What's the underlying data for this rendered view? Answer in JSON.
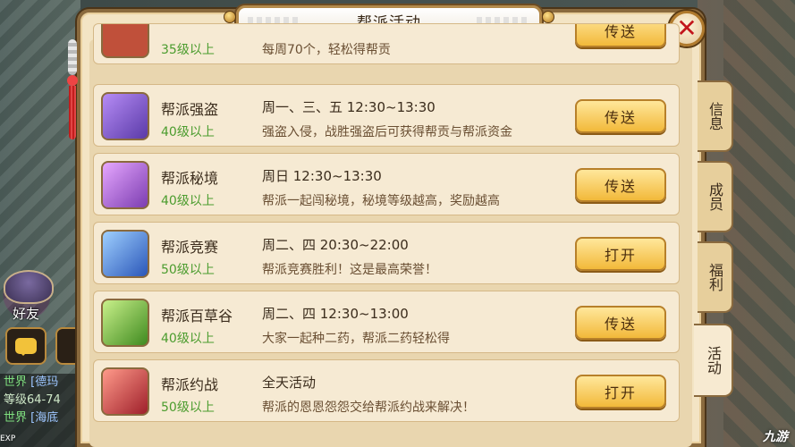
{
  "panel": {
    "title": "帮派活动"
  },
  "hud": {
    "friend_label": "好友",
    "chat_lines": [
      {
        "tag": "世界",
        "text": "[德玛"
      },
      {
        "tag": "",
        "text": "等级64-74"
      },
      {
        "tag": "世界",
        "text": "[海底"
      }
    ],
    "exp_label": "EXP"
  },
  "activities": [
    {
      "name": "",
      "level": "35级以上",
      "time": "",
      "desc": "每周70个，轻松得帮贡",
      "action": "传送",
      "icon": "banner-icon",
      "color": "#c0503a"
    },
    {
      "name": "帮派强盗",
      "level": "40级以上",
      "time": "周一、三、五 12:30~13:30",
      "desc": "强盗入侵，战胜强盗后可获得帮贡与帮派资金",
      "action": "传送",
      "icon": "bandit-icon",
      "color": "#7a55c9"
    },
    {
      "name": "帮派秘境",
      "level": "40级以上",
      "time": "周日 12:30~13:30",
      "desc": "帮派一起闯秘境，秘境等级越高，奖励越高",
      "action": "传送",
      "icon": "pagoda-icon",
      "color": "#9b57c4"
    },
    {
      "name": "帮派竞赛",
      "level": "50级以上",
      "time": "周二、四 20:30~22:00",
      "desc": "帮派竞赛胜利！这是最高荣誉！",
      "action": "打开",
      "icon": "trophy-icon",
      "color": "#3f6fd1"
    },
    {
      "name": "帮派百草谷",
      "level": "40级以上",
      "time": "周二、四 12:30~13:00",
      "desc": "大家一起种二药，帮派二药轻松得",
      "action": "传送",
      "icon": "herb-icon",
      "color": "#6bb83a"
    },
    {
      "name": "帮派约战",
      "level": "50级以上",
      "time": "全天活动",
      "desc": "帮派的恩恩怨怨交给帮派约战来解决！",
      "action": "打开",
      "icon": "battle-icon",
      "color": "#c23a3a"
    }
  ],
  "tabs": [
    {
      "label": "信息",
      "active": false
    },
    {
      "label": "成员",
      "active": false
    },
    {
      "label": "福利",
      "active": false
    },
    {
      "label": "活动",
      "active": true
    }
  ],
  "watermark": "九游",
  "close_label": "✕"
}
